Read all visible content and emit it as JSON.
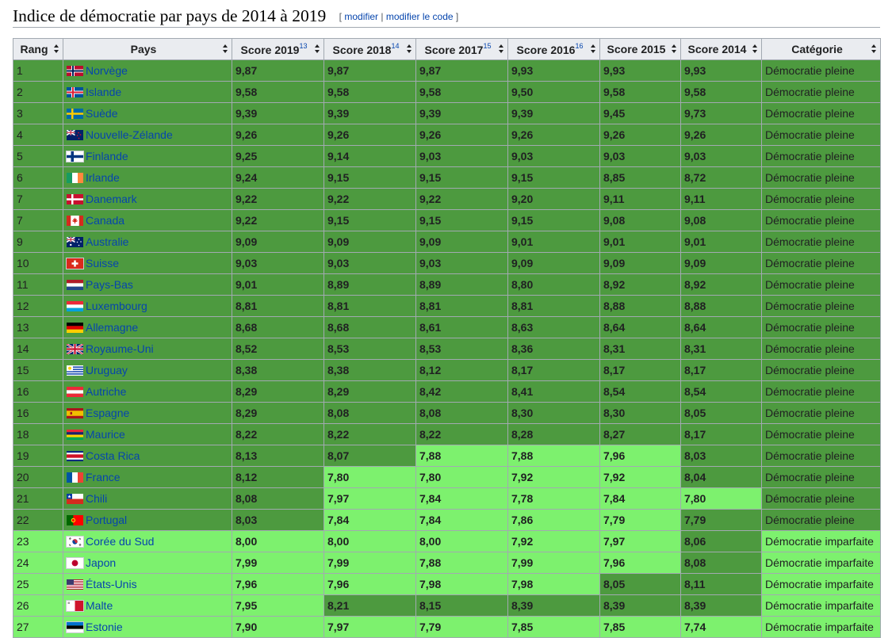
{
  "page": {
    "title": "Indice de démocratie par pays de 2014 à 2019",
    "edit_link": "modifier",
    "edit_code_link": "modifier le code",
    "edit_open": "[ ",
    "edit_sep": " | ",
    "edit_close": " ]"
  },
  "colors": {
    "full_democracy": "#4d9a3f",
    "flawed_democracy": "#7df16e",
    "link": "#0645ad"
  },
  "table": {
    "headers": [
      {
        "label": "Rang",
        "ref": ""
      },
      {
        "label": "Pays",
        "ref": ""
      },
      {
        "label": "Score 2019",
        "ref": "13"
      },
      {
        "label": "Score 2018",
        "ref": "14"
      },
      {
        "label": "Score 2017",
        "ref": "15"
      },
      {
        "label": "Score 2016",
        "ref": "16"
      },
      {
        "label": "Score 2015",
        "ref": ""
      },
      {
        "label": "Score 2014",
        "ref": ""
      },
      {
        "label": "Catégorie",
        "ref": ""
      }
    ],
    "rows": [
      {
        "rank": "1",
        "country": "Norvège",
        "flag": "norway-flag-icon",
        "scores": [
          "9,87",
          "9,87",
          "9,87",
          "9,93",
          "9,93",
          "9,93"
        ],
        "cat": "Démocratie pleine"
      },
      {
        "rank": "2",
        "country": "Islande",
        "flag": "iceland-flag-icon",
        "scores": [
          "9,58",
          "9,58",
          "9,58",
          "9,50",
          "9,58",
          "9,58"
        ],
        "cat": "Démocratie pleine"
      },
      {
        "rank": "3",
        "country": "Suède",
        "flag": "sweden-flag-icon",
        "scores": [
          "9,39",
          "9,39",
          "9,39",
          "9,39",
          "9,45",
          "9,73"
        ],
        "cat": "Démocratie pleine"
      },
      {
        "rank": "4",
        "country": "Nouvelle-Zélande",
        "flag": "new-zealand-flag-icon",
        "scores": [
          "9,26",
          "9,26",
          "9,26",
          "9,26",
          "9,26",
          "9,26"
        ],
        "cat": "Démocratie pleine"
      },
      {
        "rank": "5",
        "country": "Finlande",
        "flag": "finland-flag-icon",
        "scores": [
          "9,25",
          "9,14",
          "9,03",
          "9,03",
          "9,03",
          "9,03"
        ],
        "cat": "Démocratie pleine"
      },
      {
        "rank": "6",
        "country": "Irlande",
        "flag": "ireland-flag-icon",
        "scores": [
          "9,24",
          "9,15",
          "9,15",
          "9,15",
          "8,85",
          "8,72"
        ],
        "cat": "Démocratie pleine"
      },
      {
        "rank": "7",
        "country": "Danemark",
        "flag": "denmark-flag-icon",
        "scores": [
          "9,22",
          "9,22",
          "9,22",
          "9,20",
          "9,11",
          "9,11"
        ],
        "cat": "Démocratie pleine"
      },
      {
        "rank": "7",
        "country": "Canada",
        "flag": "canada-flag-icon",
        "scores": [
          "9,22",
          "9,15",
          "9,15",
          "9,15",
          "9,08",
          "9,08"
        ],
        "cat": "Démocratie pleine"
      },
      {
        "rank": "9",
        "country": "Australie",
        "flag": "australia-flag-icon",
        "scores": [
          "9,09",
          "9,09",
          "9,09",
          "9,01",
          "9,01",
          "9,01"
        ],
        "cat": "Démocratie pleine"
      },
      {
        "rank": "10",
        "country": "Suisse",
        "flag": "switzerland-flag-icon",
        "scores": [
          "9,03",
          "9,03",
          "9,03",
          "9,09",
          "9,09",
          "9,09"
        ],
        "cat": "Démocratie pleine"
      },
      {
        "rank": "11",
        "country": "Pays-Bas",
        "flag": "netherlands-flag-icon",
        "scores": [
          "9,01",
          "8,89",
          "8,89",
          "8,80",
          "8,92",
          "8,92"
        ],
        "cat": "Démocratie pleine"
      },
      {
        "rank": "12",
        "country": "Luxembourg",
        "flag": "luxembourg-flag-icon",
        "scores": [
          "8,81",
          "8,81",
          "8,81",
          "8,81",
          "8,88",
          "8,88"
        ],
        "cat": "Démocratie pleine"
      },
      {
        "rank": "13",
        "country": "Allemagne",
        "flag": "germany-flag-icon",
        "scores": [
          "8,68",
          "8,68",
          "8,61",
          "8,63",
          "8,64",
          "8,64"
        ],
        "cat": "Démocratie pleine"
      },
      {
        "rank": "14",
        "country": "Royaume-Uni",
        "flag": "united-kingdom-flag-icon",
        "scores": [
          "8,52",
          "8,53",
          "8,53",
          "8,36",
          "8,31",
          "8,31"
        ],
        "cat": "Démocratie pleine"
      },
      {
        "rank": "15",
        "country": "Uruguay",
        "flag": "uruguay-flag-icon",
        "scores": [
          "8,38",
          "8,38",
          "8,12",
          "8,17",
          "8,17",
          "8,17"
        ],
        "cat": "Démocratie pleine"
      },
      {
        "rank": "16",
        "country": "Autriche",
        "flag": "austria-flag-icon",
        "scores": [
          "8,29",
          "8,29",
          "8,42",
          "8,41",
          "8,54",
          "8,54"
        ],
        "cat": "Démocratie pleine"
      },
      {
        "rank": "16",
        "country": "Espagne",
        "flag": "spain-flag-icon",
        "scores": [
          "8,29",
          "8,08",
          "8,08",
          "8,30",
          "8,30",
          "8,05"
        ],
        "cat": "Démocratie pleine"
      },
      {
        "rank": "18",
        "country": "Maurice",
        "flag": "mauritius-flag-icon",
        "scores": [
          "8,22",
          "8,22",
          "8,22",
          "8,28",
          "8,27",
          "8,17"
        ],
        "cat": "Démocratie pleine"
      },
      {
        "rank": "19",
        "country": "Costa Rica",
        "flag": "costa-rica-flag-icon",
        "scores": [
          "8,13",
          "8,07",
          "7,88",
          "7,88",
          "7,96",
          "8,03"
        ],
        "cat": "Démocratie pleine"
      },
      {
        "rank": "20",
        "country": "France",
        "flag": "france-flag-icon",
        "scores": [
          "8,12",
          "7,80",
          "7,80",
          "7,92",
          "7,92",
          "8,04"
        ],
        "cat": "Démocratie pleine"
      },
      {
        "rank": "21",
        "country": "Chili",
        "flag": "chile-flag-icon",
        "scores": [
          "8,08",
          "7,97",
          "7,84",
          "7,78",
          "7,84",
          "7,80"
        ],
        "cat": "Démocratie pleine"
      },
      {
        "rank": "22",
        "country": "Portugal",
        "flag": "portugal-flag-icon",
        "scores": [
          "8,03",
          "7,84",
          "7,84",
          "7,86",
          "7,79",
          "7,79"
        ],
        "cat": "Démocratie pleine"
      },
      {
        "rank": "23",
        "country": "Corée du Sud",
        "flag": "south-korea-flag-icon",
        "scores": [
          "8,00",
          "8,00",
          "8,00",
          "7,92",
          "7,97",
          "8,06"
        ],
        "cat": "Démocratie imparfaite"
      },
      {
        "rank": "24",
        "country": "Japon",
        "flag": "japan-flag-icon",
        "scores": [
          "7,99",
          "7,99",
          "7,88",
          "7,99",
          "7,96",
          "8,08"
        ],
        "cat": "Démocratie imparfaite"
      },
      {
        "rank": "25",
        "country": "États-Unis",
        "flag": "united-states-flag-icon",
        "scores": [
          "7,96",
          "7,96",
          "7,98",
          "7,98",
          "8,05",
          "8,11"
        ],
        "cat": "Démocratie imparfaite"
      },
      {
        "rank": "26",
        "country": "Malte",
        "flag": "malta-flag-icon",
        "scores": [
          "7,95",
          "8,21",
          "8,15",
          "8,39",
          "8,39",
          "8,39"
        ],
        "cat": "Démocratie imparfaite"
      },
      {
        "rank": "27",
        "country": "Estonie",
        "flag": "estonia-flag-icon",
        "scores": [
          "7,90",
          "7,97",
          "7,79",
          "7,85",
          "7,85",
          "7,74"
        ],
        "cat": "Démocratie imparfaite"
      }
    ]
  }
}
